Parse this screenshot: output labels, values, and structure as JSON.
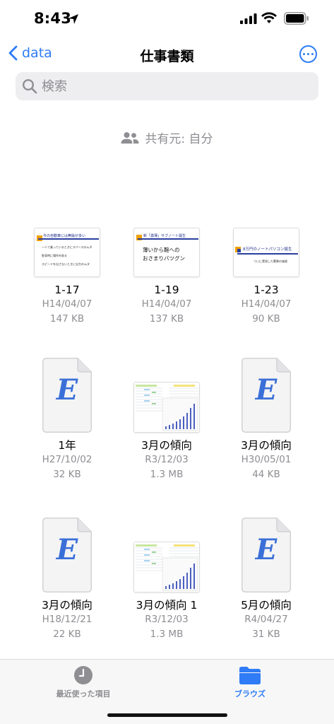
{
  "status": {
    "time": "8:43"
  },
  "nav": {
    "back_label": "data",
    "title": "仕事書類"
  },
  "search": {
    "placeholder": "検索"
  },
  "shared": {
    "label": "共有元: 自分"
  },
  "files": [
    {
      "name": "1-17",
      "date": "H14/04/07",
      "size": "147 KB",
      "kind": "slide",
      "slide_title": "今の自動車には無駄が多い",
      "slide_lines": [
        "一人で乗っているときにスペースのムダ",
        "駐車時に場所を取る",
        "スピードを出さないときに出力のムダ"
      ]
    },
    {
      "name": "1-19",
      "date": "H14/04/07",
      "size": "137 KB",
      "kind": "slide",
      "slide_title": "新「激薄」サブノート誕生",
      "slide_lines": [
        "薄いから鞄への",
        "おさまりバツグン"
      ]
    },
    {
      "name": "1-23",
      "date": "H14/04/07",
      "size": "90 KB",
      "kind": "slide",
      "slide_title": "8万円のノートパソコン誕生",
      "slide_lines": [
        "ついに実現した驚異の価格"
      ]
    },
    {
      "name": "1年",
      "date": "H27/10/02",
      "size": "32 KB",
      "kind": "doc",
      "letter": "E"
    },
    {
      "name": "3月の傾向",
      "date": "R3/12/03",
      "size": "1.3 MB",
      "kind": "sheet"
    },
    {
      "name": "3月の傾向",
      "date": "H30/05/01",
      "size": "44 KB",
      "kind": "doc",
      "letter": "E"
    },
    {
      "name": "3月の傾向",
      "date": "H18/12/21",
      "size": "22 KB",
      "kind": "doc",
      "letter": "E"
    },
    {
      "name": "3月の傾向 1",
      "date": "R3/12/03",
      "size": "1.3 MB",
      "kind": "sheet"
    },
    {
      "name": "5月の傾向",
      "date": "R4/04/27",
      "size": "31 KB",
      "kind": "doc",
      "letter": "E"
    }
  ],
  "tabs": [
    {
      "label": "最近使った項目",
      "icon": "clock-icon",
      "color": "#8e8e93"
    },
    {
      "label": "ブラウズ",
      "icon": "folder-icon",
      "color": "#2f7cf6"
    }
  ],
  "colors": {
    "accent": "#2f7cf6",
    "secondary_text": "#8e8e93"
  }
}
